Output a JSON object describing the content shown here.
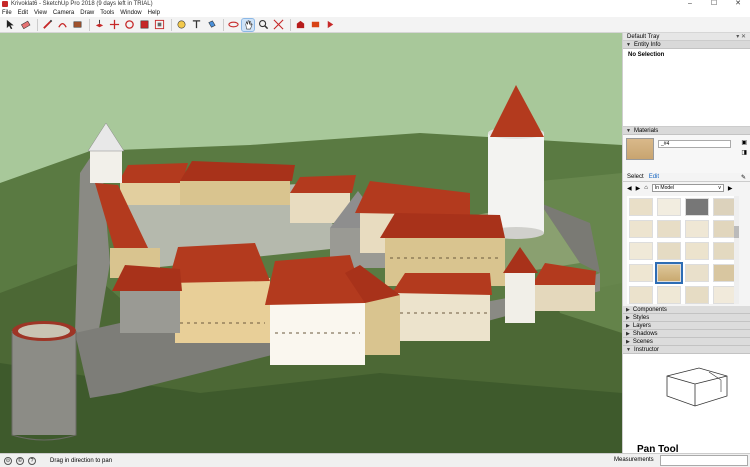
{
  "window": {
    "title": "Krivoklat6 - SketchUp Pro 2018 (9 days left in TRIAL)",
    "min": "–",
    "max": "☐",
    "close": "✕"
  },
  "menu": [
    "File",
    "Edit",
    "View",
    "Camera",
    "Draw",
    "Tools",
    "Window",
    "Help"
  ],
  "toolbar": {
    "tools": [
      "select",
      "eraser",
      "line",
      "arc",
      "rectangle",
      "push-pull",
      "move",
      "rotate",
      "scale",
      "offset",
      "tape-measure",
      "text",
      "paint-bucket",
      "orbit",
      "pan",
      "zoom",
      "zoom-extents",
      "3d-warehouse",
      "extension-warehouse",
      "layout"
    ],
    "active_tool": "pan"
  },
  "tray": {
    "title": "Default Tray",
    "entity_info": {
      "heading": "Entity Info",
      "value": "No Selection"
    },
    "materials": {
      "heading": "Materials",
      "name": "_#4",
      "tab_select": "Select",
      "tab_edit": "Edit",
      "dropdown": "In Model"
    },
    "panels": [
      "Components",
      "Styles",
      "Layers",
      "Shadows",
      "Scenes",
      "Instructor"
    ],
    "instructor_title": "Pan Tool"
  },
  "status": {
    "message": "Drag in direction to pan",
    "measurements_label": "Measurements",
    "icons": [
      "geo-location-icon",
      "credits-icon",
      "help-icon"
    ]
  },
  "colors": {
    "roof": "#b33a1e",
    "wall": "#e8dcc0",
    "stone": "#8a8a84",
    "sky": "#a8c89a",
    "terrain": "#4f6b3a",
    "selection": "#2d6db5"
  }
}
